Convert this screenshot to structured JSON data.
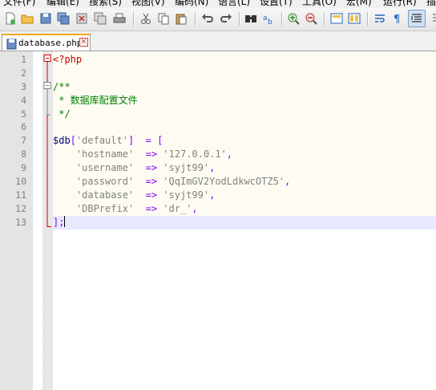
{
  "menu": {
    "items": [
      "文件(F)",
      "编辑(E)",
      "搜索(S)",
      "视图(V)",
      "编码(N)",
      "语言(L)",
      "设置(T)",
      "工具(O)",
      "宏(M)",
      "运行(R)",
      "插"
    ]
  },
  "toolbar": {
    "buttons": [
      "new-file-icon",
      "open-file-icon",
      "save-icon",
      "save-all-icon",
      "close-icon",
      "close-all-icon",
      "print-icon",
      "cut-icon",
      "copy-icon",
      "paste-icon",
      "undo-icon",
      "redo-icon",
      "find-icon",
      "replace-icon",
      "zoom-in-icon",
      "zoom-out-icon",
      "sync-vertical-icon",
      "sync-horizontal-icon",
      "word-wrap-icon",
      "show-all-chars-icon",
      "indent-guide-icon"
    ]
  },
  "tabs": [
    {
      "label": "database.php",
      "close": "✕",
      "active": true
    }
  ],
  "editor": {
    "line_numbers": [
      "1",
      "2",
      "3",
      "4",
      "5",
      "6",
      "7",
      "8",
      "9",
      "10",
      "11",
      "12",
      "13"
    ],
    "lines": [
      [
        {
          "t": "<?php",
          "c": "c-phptag"
        }
      ],
      [],
      [
        {
          "t": "/**",
          "c": "c-comment"
        }
      ],
      [
        {
          "t": " * 数据库配置文件",
          "c": "c-comment"
        }
      ],
      [
        {
          "t": " */",
          "c": "c-comment"
        }
      ],
      [],
      [
        {
          "t": "$db",
          "c": "c-var"
        },
        {
          "t": "[",
          "c": "c-op"
        },
        {
          "t": "'default'",
          "c": "c-str"
        },
        {
          "t": "]  ",
          "c": "c-op"
        },
        {
          "t": "= [",
          "c": "c-op"
        }
      ],
      [
        {
          "t": "    ",
          "c": "c-text"
        },
        {
          "t": "'hostname'",
          "c": "c-str"
        },
        {
          "t": "  ",
          "c": "c-text"
        },
        {
          "t": "=>",
          "c": "c-op"
        },
        {
          "t": " ",
          "c": "c-text"
        },
        {
          "t": "'127.0.0.1'",
          "c": "c-str"
        },
        {
          "t": ",",
          "c": "c-op"
        }
      ],
      [
        {
          "t": "    ",
          "c": "c-text"
        },
        {
          "t": "'username'",
          "c": "c-str"
        },
        {
          "t": "  ",
          "c": "c-text"
        },
        {
          "t": "=>",
          "c": "c-op"
        },
        {
          "t": " ",
          "c": "c-text"
        },
        {
          "t": "'syjt99'",
          "c": "c-str"
        },
        {
          "t": ",",
          "c": "c-op"
        }
      ],
      [
        {
          "t": "    ",
          "c": "c-text"
        },
        {
          "t": "'password'",
          "c": "c-str"
        },
        {
          "t": "  ",
          "c": "c-text"
        },
        {
          "t": "=>",
          "c": "c-op"
        },
        {
          "t": " ",
          "c": "c-text"
        },
        {
          "t": "'QqImGV2YodLdkwcOTZ5'",
          "c": "c-str"
        },
        {
          "t": ",",
          "c": "c-op"
        }
      ],
      [
        {
          "t": "    ",
          "c": "c-text"
        },
        {
          "t": "'database'",
          "c": "c-str"
        },
        {
          "t": "  ",
          "c": "c-text"
        },
        {
          "t": "=>",
          "c": "c-op"
        },
        {
          "t": " ",
          "c": "c-text"
        },
        {
          "t": "'syjt99'",
          "c": "c-str"
        },
        {
          "t": ",",
          "c": "c-op"
        }
      ],
      [
        {
          "t": "    ",
          "c": "c-text"
        },
        {
          "t": "'DBPrefix'",
          "c": "c-str"
        },
        {
          "t": "  ",
          "c": "c-text"
        },
        {
          "t": "=>",
          "c": "c-op"
        },
        {
          "t": " ",
          "c": "c-text"
        },
        {
          "t": "'dr_'",
          "c": "c-str"
        },
        {
          "t": ",",
          "c": "c-op"
        }
      ],
      [
        {
          "t": "];",
          "c": "c-op"
        }
      ]
    ],
    "current_line": 13
  },
  "colors": {
    "php_tag": "#cc0000",
    "variable": "#000080",
    "operator": "#8000ff",
    "string": "#808080",
    "comment": "#008000",
    "current_line_bg": "#e8e8ff",
    "tab_accent": "#f5a623"
  }
}
